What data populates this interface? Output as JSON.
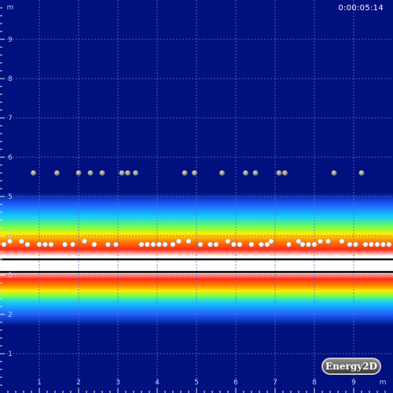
{
  "simulation": {
    "elapsed_time": "0:00:05:14",
    "brand": "Energy2D",
    "axis_unit": "m",
    "x_ticks": [
      "1",
      "2",
      "3",
      "4",
      "5",
      "6",
      "7",
      "8",
      "9"
    ],
    "y_ticks": [
      "9",
      "8",
      "7",
      "6",
      "5",
      "4",
      "3",
      "2",
      "1"
    ],
    "x_range_m": [
      0,
      10
    ],
    "y_range_m": [
      0,
      10
    ],
    "colors": {
      "background": "#00107f",
      "grid": "#5a70c8",
      "tick_text": "#bcc9ff",
      "particle_white": "#ffffff",
      "particle_gray": "#9a9a9a",
      "plate": "#000000"
    },
    "plates_y_m": [
      3.4,
      3.08
    ],
    "gray_particles_x_m": [
      0.85,
      1.45,
      2.0,
      2.3,
      2.6,
      3.1,
      3.25,
      3.45,
      4.7,
      4.95,
      5.65,
      6.25,
      6.5,
      7.1,
      7.25,
      8.5,
      9.2
    ],
    "gray_particles_y_m": 5.6,
    "white_particles_upper_x_m": [
      0.25,
      0.55,
      2.15,
      4.55,
      4.8,
      5.8,
      6.9,
      7.6,
      8.15,
      8.35,
      8.7
    ],
    "white_particles_upper_y_m": 3.86,
    "white_particles_lower_x_m": [
      0.1,
      0.7,
      1.0,
      1.15,
      1.3,
      1.65,
      1.85,
      2.4,
      2.75,
      2.95,
      3.6,
      3.75,
      3.9,
      4.05,
      4.2,
      4.4,
      5.1,
      5.35,
      5.5,
      5.95,
      6.1,
      6.4,
      6.65,
      6.8,
      7.35,
      7.7,
      7.85,
      8.0,
      8.9,
      9.05,
      9.3,
      9.45,
      9.6,
      9.75,
      9.9
    ]
  }
}
